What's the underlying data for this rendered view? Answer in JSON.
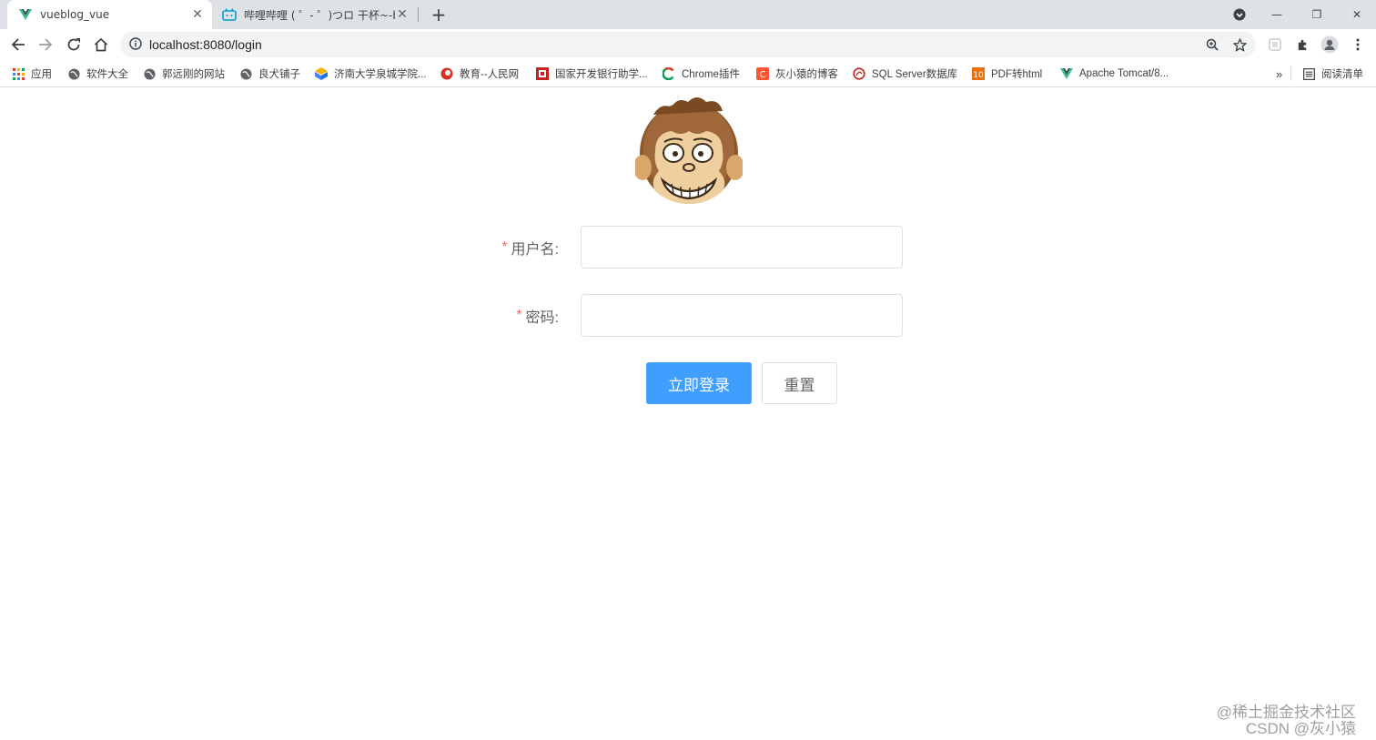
{
  "tabs": [
    {
      "title": "vueblog_vue",
      "close": "✕"
    },
    {
      "title": "哔哩哔哩 ( ゜- ゜)つロ 干杯~-bilibili",
      "close": "✕"
    }
  ],
  "newtab": "+",
  "window": {
    "minimize": "—",
    "restore": "❐",
    "close": "✕"
  },
  "address": {
    "url": "localhost:8080/login"
  },
  "bookmarks": [
    {
      "label": "应用"
    },
    {
      "label": "软件大全"
    },
    {
      "label": "郭远刚的网站"
    },
    {
      "label": "良犬铺子"
    },
    {
      "label": "济南大学泉城学院..."
    },
    {
      "label": "教育--人民网"
    },
    {
      "label": "国家开发银行助学..."
    },
    {
      "label": "Chrome插件"
    },
    {
      "label": "灰小猿的博客"
    },
    {
      "label": "SQL Server数据库"
    },
    {
      "label": "PDF转html"
    },
    {
      "label": "Apache Tomcat/8..."
    }
  ],
  "bookmarks_more": "»",
  "reading_list": "阅读清单",
  "form": {
    "required_mark": "*",
    "username_label": "用户名:",
    "password_label": "密码:",
    "username_value": "",
    "password_value": "",
    "login_button": "立即登录",
    "reset_button": "重置"
  },
  "watermark": {
    "line1": "@稀土掘金技术社区",
    "line2": "CSDN @灰小猿"
  },
  "colors": {
    "primary": "#409eff",
    "required": "#f56c6c",
    "label": "#606266",
    "border": "#dcdfe6"
  }
}
